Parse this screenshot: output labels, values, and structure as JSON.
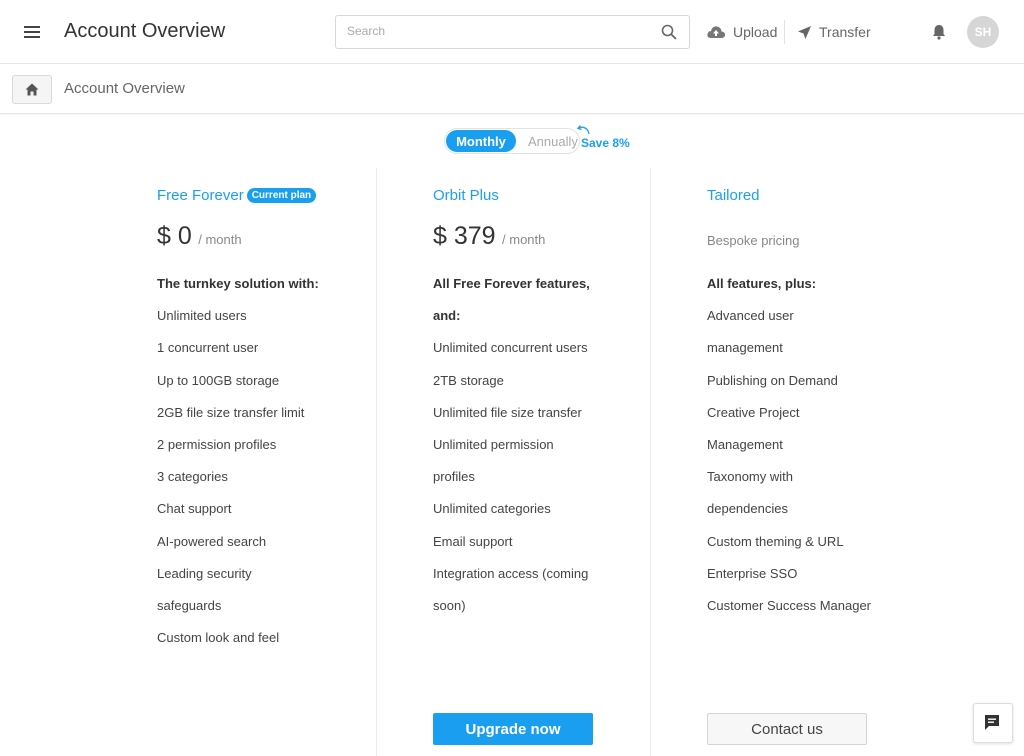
{
  "header": {
    "title": "Account Overview",
    "search_placeholder": "Search",
    "upload_label": "Upload",
    "transfer_label": "Transfer",
    "avatar_initials": "SH"
  },
  "breadcrumb": {
    "current": "Account Overview"
  },
  "billing_toggle": {
    "monthly_label": "Monthly",
    "annually_label": "Annually",
    "save_note": "Save 8%",
    "selected": "Monthly"
  },
  "plans": [
    {
      "name": "Free Forever",
      "badge": "Current plan",
      "price_amount": "$ 0",
      "price_period": "/ month",
      "features": [
        "The turnkey solution with:",
        "Unlimited users",
        "1 concurrent user",
        "Up to 100GB storage",
        "2GB file size transfer limit",
        "2 permission profiles",
        "3 categories",
        "Chat support",
        "AI-powered search",
        "Leading security",
        "safeguards",
        "Custom look and feel"
      ]
    },
    {
      "name": "Orbit Plus",
      "price_amount": "$ 379",
      "price_period": "/ month",
      "features": [
        "All Free Forever features,",
        "and:",
        "Unlimited concurrent users",
        "2TB storage",
        "Unlimited file size transfer",
        "Unlimited permission",
        "profiles",
        "Unlimited categories",
        "Email support",
        "Integration access (coming",
        "soon)"
      ],
      "cta": "Upgrade now"
    },
    {
      "name": "Tailored",
      "price_text": "Bespoke pricing",
      "features": [
        "All features, plus:",
        "Advanced user",
        "management",
        "Publishing on Demand",
        "Creative Project",
        "Management",
        "Taxonomy with",
        "dependencies",
        "Custom theming & URL",
        "Enterprise SSO",
        "Customer Success Manager"
      ],
      "cta": "Contact us"
    }
  ],
  "colors": {
    "accent": "#1a9ff0",
    "text": "#333333",
    "muted": "#888888"
  },
  "icons": [
    "menu-icon",
    "search-icon",
    "cloud-upload-icon",
    "send-icon",
    "bell-icon",
    "home-icon",
    "curved-arrow-icon",
    "chat-icon"
  ]
}
